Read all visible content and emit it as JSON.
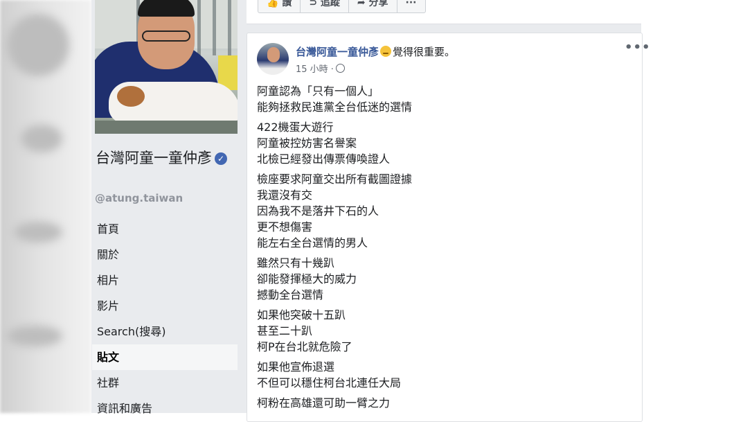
{
  "top_bar": {
    "buttons": [
      {
        "icon": "thumb-icon",
        "label": "讚"
      },
      {
        "icon": "rss-icon",
        "label": "追蹤"
      },
      {
        "icon": "share-icon",
        "label": "分享"
      },
      {
        "icon": "more-icon",
        "label": "···"
      }
    ]
  },
  "page": {
    "name": "台灣阿童一童仲彥",
    "verified": true,
    "handle": "@atung.taiwan",
    "nav": [
      {
        "label": "首頁"
      },
      {
        "label": "關於"
      },
      {
        "label": "相片"
      },
      {
        "label": "影片"
      },
      {
        "label": "Search(搜尋)"
      },
      {
        "label": "貼文",
        "active": true
      },
      {
        "label": "社群"
      },
      {
        "label": "資訊和廣告"
      }
    ]
  },
  "post": {
    "author": "台灣阿童一童仲彥",
    "feeling": "覺得很重要。",
    "time": "15 小時 ·",
    "privacy_icon": "globe-icon",
    "more_label": "•••",
    "paragraphs": [
      [
        "阿童認為「只有一個人」",
        "能夠拯救民進黨全台低迷的選情"
      ],
      [
        "422機蛋大遊行",
        "阿童被控妨害名譽案",
        "北檢已經發出傳票傳喚證人"
      ],
      [
        "檢座要求阿童交出所有截圖證據",
        "我還沒有交",
        "因為我不是落井下石的人",
        "更不想傷害",
        "能左右全台選情的男人"
      ],
      [
        "雖然只有十幾趴",
        "卻能發揮極大的威力",
        "撼動全台選情"
      ],
      [
        "如果他突破十五趴",
        "甚至二十趴",
        "柯P在台北就危險了"
      ],
      [
        "如果他宣佈退選",
        "不但可以穩住柯台北連任大局"
      ],
      [
        "柯粉在高雄還可助一臂之力"
      ]
    ]
  },
  "colors": {
    "link": "#385898",
    "background": "#e9ebee",
    "verified": "#4267b2"
  }
}
